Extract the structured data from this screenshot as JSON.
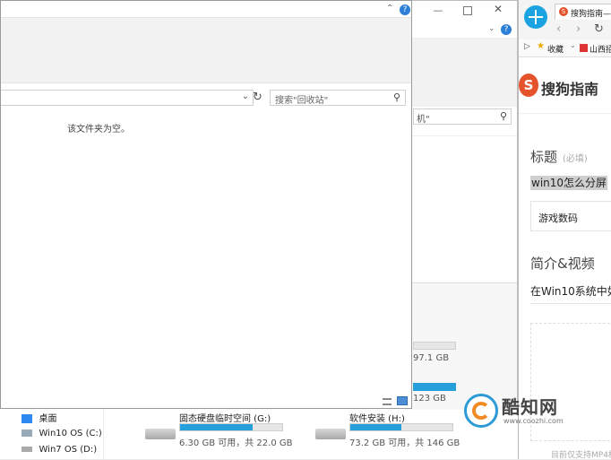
{
  "recycle_window": {
    "search_placeholder": "搜索\"回收站\"",
    "empty_message": "该文件夹为空。"
  },
  "pc_window": {
    "search_partial": "机\"",
    "drives": [
      {
        "name": "固态硬盘临时空间 (G:)",
        "free": "6.30 GB 可用，共 22.0 GB",
        "fill": 0.71
      },
      {
        "name": "软件安装 (H:)",
        "free": "73.2 GB 可用，共 146 GB",
        "fill": 0.5
      }
    ],
    "partial_values": [
      "97.1 GB",
      "123 GB"
    ],
    "nav_items": [
      {
        "label": "桌面"
      },
      {
        "label": "Win10 OS (C:)"
      },
      {
        "label": "Win7 OS (D:)"
      }
    ]
  },
  "browser": {
    "tab_title": "搜狗指南—",
    "bookmarks": [
      "收藏",
      "山西招"
    ],
    "brand": "搜狗指南",
    "title_label": "标题",
    "title_required": "(必填)",
    "title_value": "win10怎么分屏",
    "category": "游戏数码",
    "intro_label": "简介&视频",
    "intro_text": "在Win10系统中如",
    "upload_note": "目前仅支持MP4格"
  },
  "watermark": {
    "name": "酷知网",
    "url": "www.coozhi.com"
  },
  "colors": {
    "accent": "#26a0da",
    "sogou_red": "#e5532d"
  }
}
